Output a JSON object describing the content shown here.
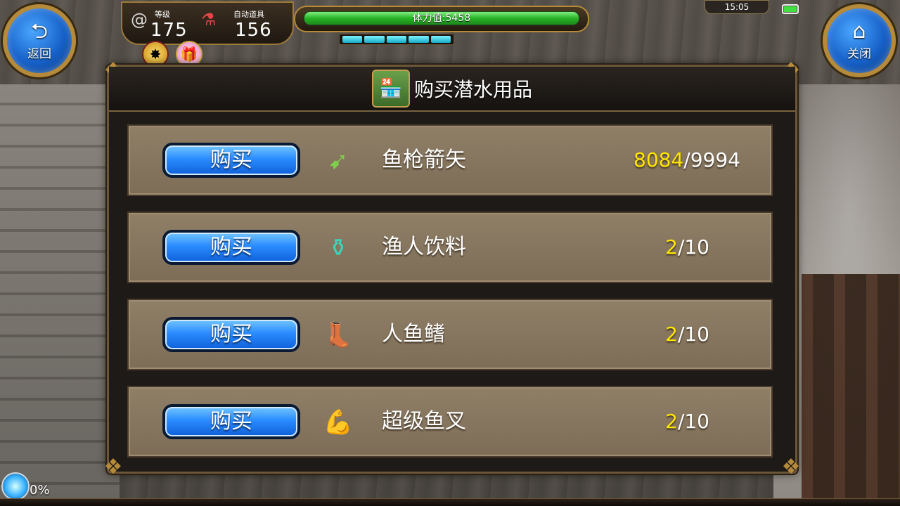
{
  "hud": {
    "back_label": "返回",
    "close_label": "关闭",
    "level_label": "等级",
    "level_value": "175",
    "auto_items_label": "自动道具",
    "auto_items_value": "156",
    "stamina_text": "体力值:5458",
    "energy_segments": 5,
    "clock": "15:05"
  },
  "dialog": {
    "title": "购买潜水用品",
    "items": [
      {
        "buy_label": "购买",
        "name": "鱼枪箭矢",
        "current": "8084",
        "total": "/9994",
        "icon": "arrow-icon"
      },
      {
        "buy_label": "购买",
        "name": "渔人饮料",
        "current": "2",
        "total": "/10",
        "icon": "potion-icon"
      },
      {
        "buy_label": "购买",
        "name": "人鱼鳍",
        "current": "2",
        "total": "/10",
        "icon": "boot-icon"
      },
      {
        "buy_label": "购买",
        "name": "超级鱼叉",
        "current": "2",
        "total": "/10",
        "icon": "muscle-icon"
      }
    ]
  },
  "footer": {
    "progress_text": "0%"
  },
  "colors": {
    "button_blue": "#2a8cff",
    "count_highlight": "#ffe600",
    "stamina_green": "#27b227",
    "energy_cyan": "#14a9c4"
  }
}
